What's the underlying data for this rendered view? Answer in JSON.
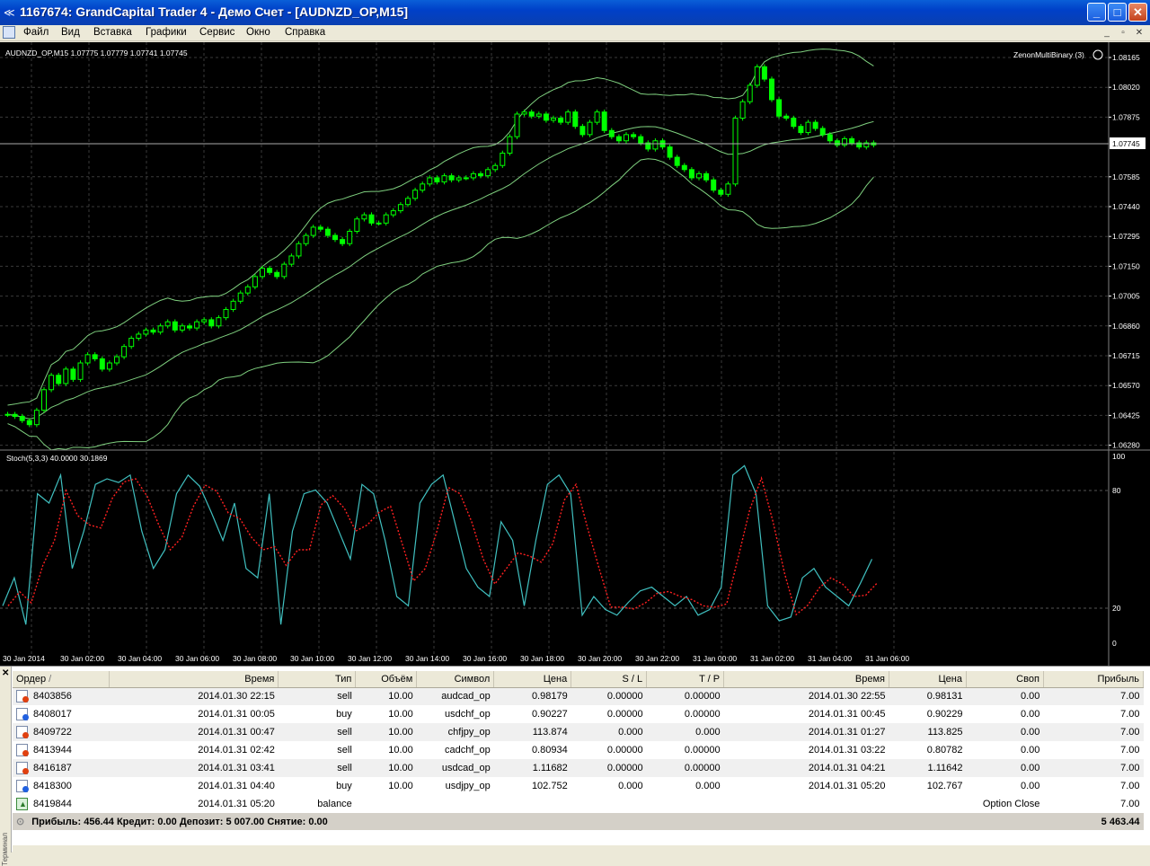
{
  "window": {
    "title": "1167674: GrandCapital Trader 4 - Демо Счет - [AUDNZD_OP,M15]",
    "controls": [
      "_",
      "□",
      "✕"
    ]
  },
  "menu": {
    "items": [
      "Файл",
      "Вид",
      "Вставка",
      "Графики",
      "Сервис",
      "Окно",
      "Справка"
    ]
  },
  "chart": {
    "header": "AUDNZD_OP,M15  1.07775 1.07779 1.07741 1.07745",
    "expert": "ZenonMultiBinary (3)",
    "current_price": "1.07745",
    "price_labels": [
      "1.08165",
      "1.08020",
      "1.07875",
      "1.07745",
      "1.07585",
      "1.07440",
      "1.07295",
      "1.07150",
      "1.07005",
      "1.06860",
      "1.06715",
      "1.06570",
      "1.06425",
      "1.06280"
    ],
    "stoch_header": "Stoch(5,3,3) 40.0000 30.1869",
    "stoch_levels": [
      "100",
      "80",
      "20",
      "0"
    ],
    "time_labels": [
      "30 Jan 2014",
      "30 Jan 02:00",
      "30 Jan 04:00",
      "30 Jan 06:00",
      "30 Jan 08:00",
      "30 Jan 10:00",
      "30 Jan 12:00",
      "30 Jan 14:00",
      "30 Jan 16:00",
      "30 Jan 18:00",
      "30 Jan 20:00",
      "30 Jan 22:00",
      "31 Jan 00:00",
      "31 Jan 02:00",
      "31 Jan 04:00",
      "31 Jan 06:00"
    ],
    "colors": {
      "background": "#000000",
      "candles": "#00ff00",
      "bands": "#7fd07f",
      "stoch_main": "#40c0c0",
      "stoch_signal": "#ff2020",
      "grid": "#404040"
    }
  },
  "terminal": {
    "side_label": "Терминал",
    "columns": [
      "Ордер",
      "Время",
      "Тип",
      "Объём",
      "Символ",
      "Цена",
      "S / L",
      "T / P",
      "Время",
      "Цена",
      "Своп",
      "Прибыль"
    ],
    "rows": [
      {
        "icon": "sell",
        "order": "8403856",
        "open_time": "2014.01.30 22:15",
        "type": "sell",
        "volume": "10.00",
        "symbol": "audcad_op",
        "price": "0.98179",
        "sl": "0.00000",
        "tp": "0.00000",
        "close_time": "2014.01.30 22:55",
        "close_price": "0.98131",
        "swap": "0.00",
        "profit": "7.00"
      },
      {
        "icon": "buy",
        "order": "8408017",
        "open_time": "2014.01.31 00:05",
        "type": "buy",
        "volume": "10.00",
        "symbol": "usdchf_op",
        "price": "0.90227",
        "sl": "0.00000",
        "tp": "0.00000",
        "close_time": "2014.01.31 00:45",
        "close_price": "0.90229",
        "swap": "0.00",
        "profit": "7.00"
      },
      {
        "icon": "sell",
        "order": "8409722",
        "open_time": "2014.01.31 00:47",
        "type": "sell",
        "volume": "10.00",
        "symbol": "chfjpy_op",
        "price": "113.874",
        "sl": "0.000",
        "tp": "0.000",
        "close_time": "2014.01.31 01:27",
        "close_price": "113.825",
        "swap": "0.00",
        "profit": "7.00"
      },
      {
        "icon": "sell",
        "order": "8413944",
        "open_time": "2014.01.31 02:42",
        "type": "sell",
        "volume": "10.00",
        "symbol": "cadchf_op",
        "price": "0.80934",
        "sl": "0.00000",
        "tp": "0.00000",
        "close_time": "2014.01.31 03:22",
        "close_price": "0.80782",
        "swap": "0.00",
        "profit": "7.00"
      },
      {
        "icon": "sell",
        "order": "8416187",
        "open_time": "2014.01.31 03:41",
        "type": "sell",
        "volume": "10.00",
        "symbol": "usdcad_op",
        "price": "1.11682",
        "sl": "0.00000",
        "tp": "0.00000",
        "close_time": "2014.01.31 04:21",
        "close_price": "1.11642",
        "swap": "0.00",
        "profit": "7.00"
      },
      {
        "icon": "buy",
        "order": "8418300",
        "open_time": "2014.01.31 04:40",
        "type": "buy",
        "volume": "10.00",
        "symbol": "usdjpy_op",
        "price": "102.752",
        "sl": "0.000",
        "tp": "0.000",
        "close_time": "2014.01.31 05:20",
        "close_price": "102.767",
        "swap": "0.00",
        "profit": "7.00"
      }
    ],
    "balance_row": {
      "order": "8419844",
      "time": "2014.01.31 05:20",
      "type": "balance",
      "comment": "Option Close",
      "profit": "7.00"
    },
    "summary": {
      "text": "Прибыль: 456.44  Кредит: 0.00  Депозит: 5 007.00  Снятие: 0.00",
      "total": "5 463.44"
    }
  }
}
